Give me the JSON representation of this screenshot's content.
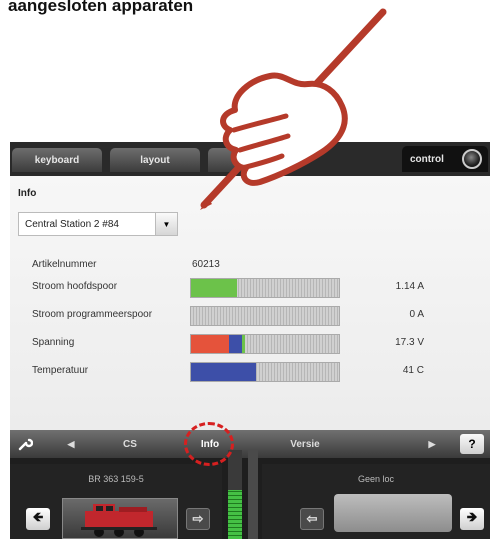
{
  "heading": "aangesloten apparaten",
  "tabs": {
    "keyboard": "keyboard",
    "layout": "layout",
    "control": "control"
  },
  "panel": {
    "title": "Info",
    "device_select": {
      "value": "Central Station 2 #84"
    },
    "article": {
      "label": "Artikelnummer",
      "value": "60213"
    },
    "rows": [
      {
        "label": "Stroom hoofdspoor",
        "value": "1.14 A",
        "segments": [
          {
            "color": "#6cc24a",
            "fraction": 0.31
          }
        ]
      },
      {
        "label": "Stroom programmeerspoor",
        "value": "0 A",
        "segments": []
      },
      {
        "label": "Spanning",
        "value": "17.3 V",
        "segments": [
          {
            "color": "#e5533b",
            "fraction": 0.26
          },
          {
            "color": "#3d4fa8",
            "fraction": 0.09
          },
          {
            "color": "#6cc24a",
            "fraction": 0.02
          }
        ]
      },
      {
        "label": "Temperatuur",
        "value": "41 C",
        "segments": [
          {
            "color": "#3d4fa8",
            "fraction": 0.44
          }
        ]
      }
    ]
  },
  "navbar": {
    "prev": "CS",
    "current": "Info",
    "next": "Versie",
    "help": "?"
  },
  "locos": {
    "left": {
      "name": "BR 363 159-5"
    },
    "right": {
      "name": "Geen loc"
    },
    "speed_level": 0.55
  },
  "icons": [
    "pen-hand-icon",
    "knob-icon",
    "chevron-down-icon",
    "wrench-icon",
    "arrow-left-icon",
    "arrow-right-icon",
    "locomotive-icon"
  ],
  "colors": {
    "highlight_ring": "#d62020",
    "accent_green": "#6cc24a"
  }
}
